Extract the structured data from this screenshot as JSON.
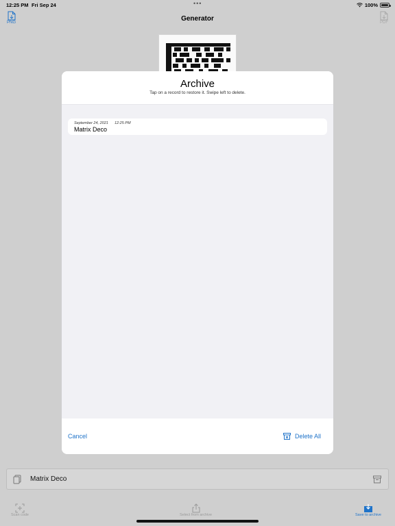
{
  "status_bar": {
    "time": "12:25 PM",
    "date": "Fri Sep 24",
    "multitask": "•••",
    "battery": "100%"
  },
  "header": {
    "title": "Generator",
    "png_label": "PNG",
    "pdf_label": "PDF"
  },
  "modal": {
    "title": "Archive",
    "subtitle": "Tap on a record to restore it. Swipe left to delete.",
    "records": [
      {
        "date": "September 24, 2021",
        "time": "12:25 PM",
        "title": "Matrix Deco"
      }
    ],
    "cancel_label": "Cancel",
    "delete_all_label": "Delete All"
  },
  "current_record": {
    "label": "Matrix Deco"
  },
  "toolbar": {
    "scan_label": "Scan code",
    "select_label": "Select from archive",
    "save_label": "Save to archive"
  },
  "colors": {
    "accent": "#1f73c9",
    "dimmed_bg": "#cfcfcf",
    "modal_bg": "#f1f1f5"
  },
  "icons": [
    "wifi-icon",
    "battery-icon",
    "png-file-icon",
    "pdf-file-icon",
    "barcode-image",
    "copy-icon",
    "archive-box-icon",
    "scan-icon",
    "share-icon",
    "save-archive-icon",
    "trash-box-icon"
  ]
}
